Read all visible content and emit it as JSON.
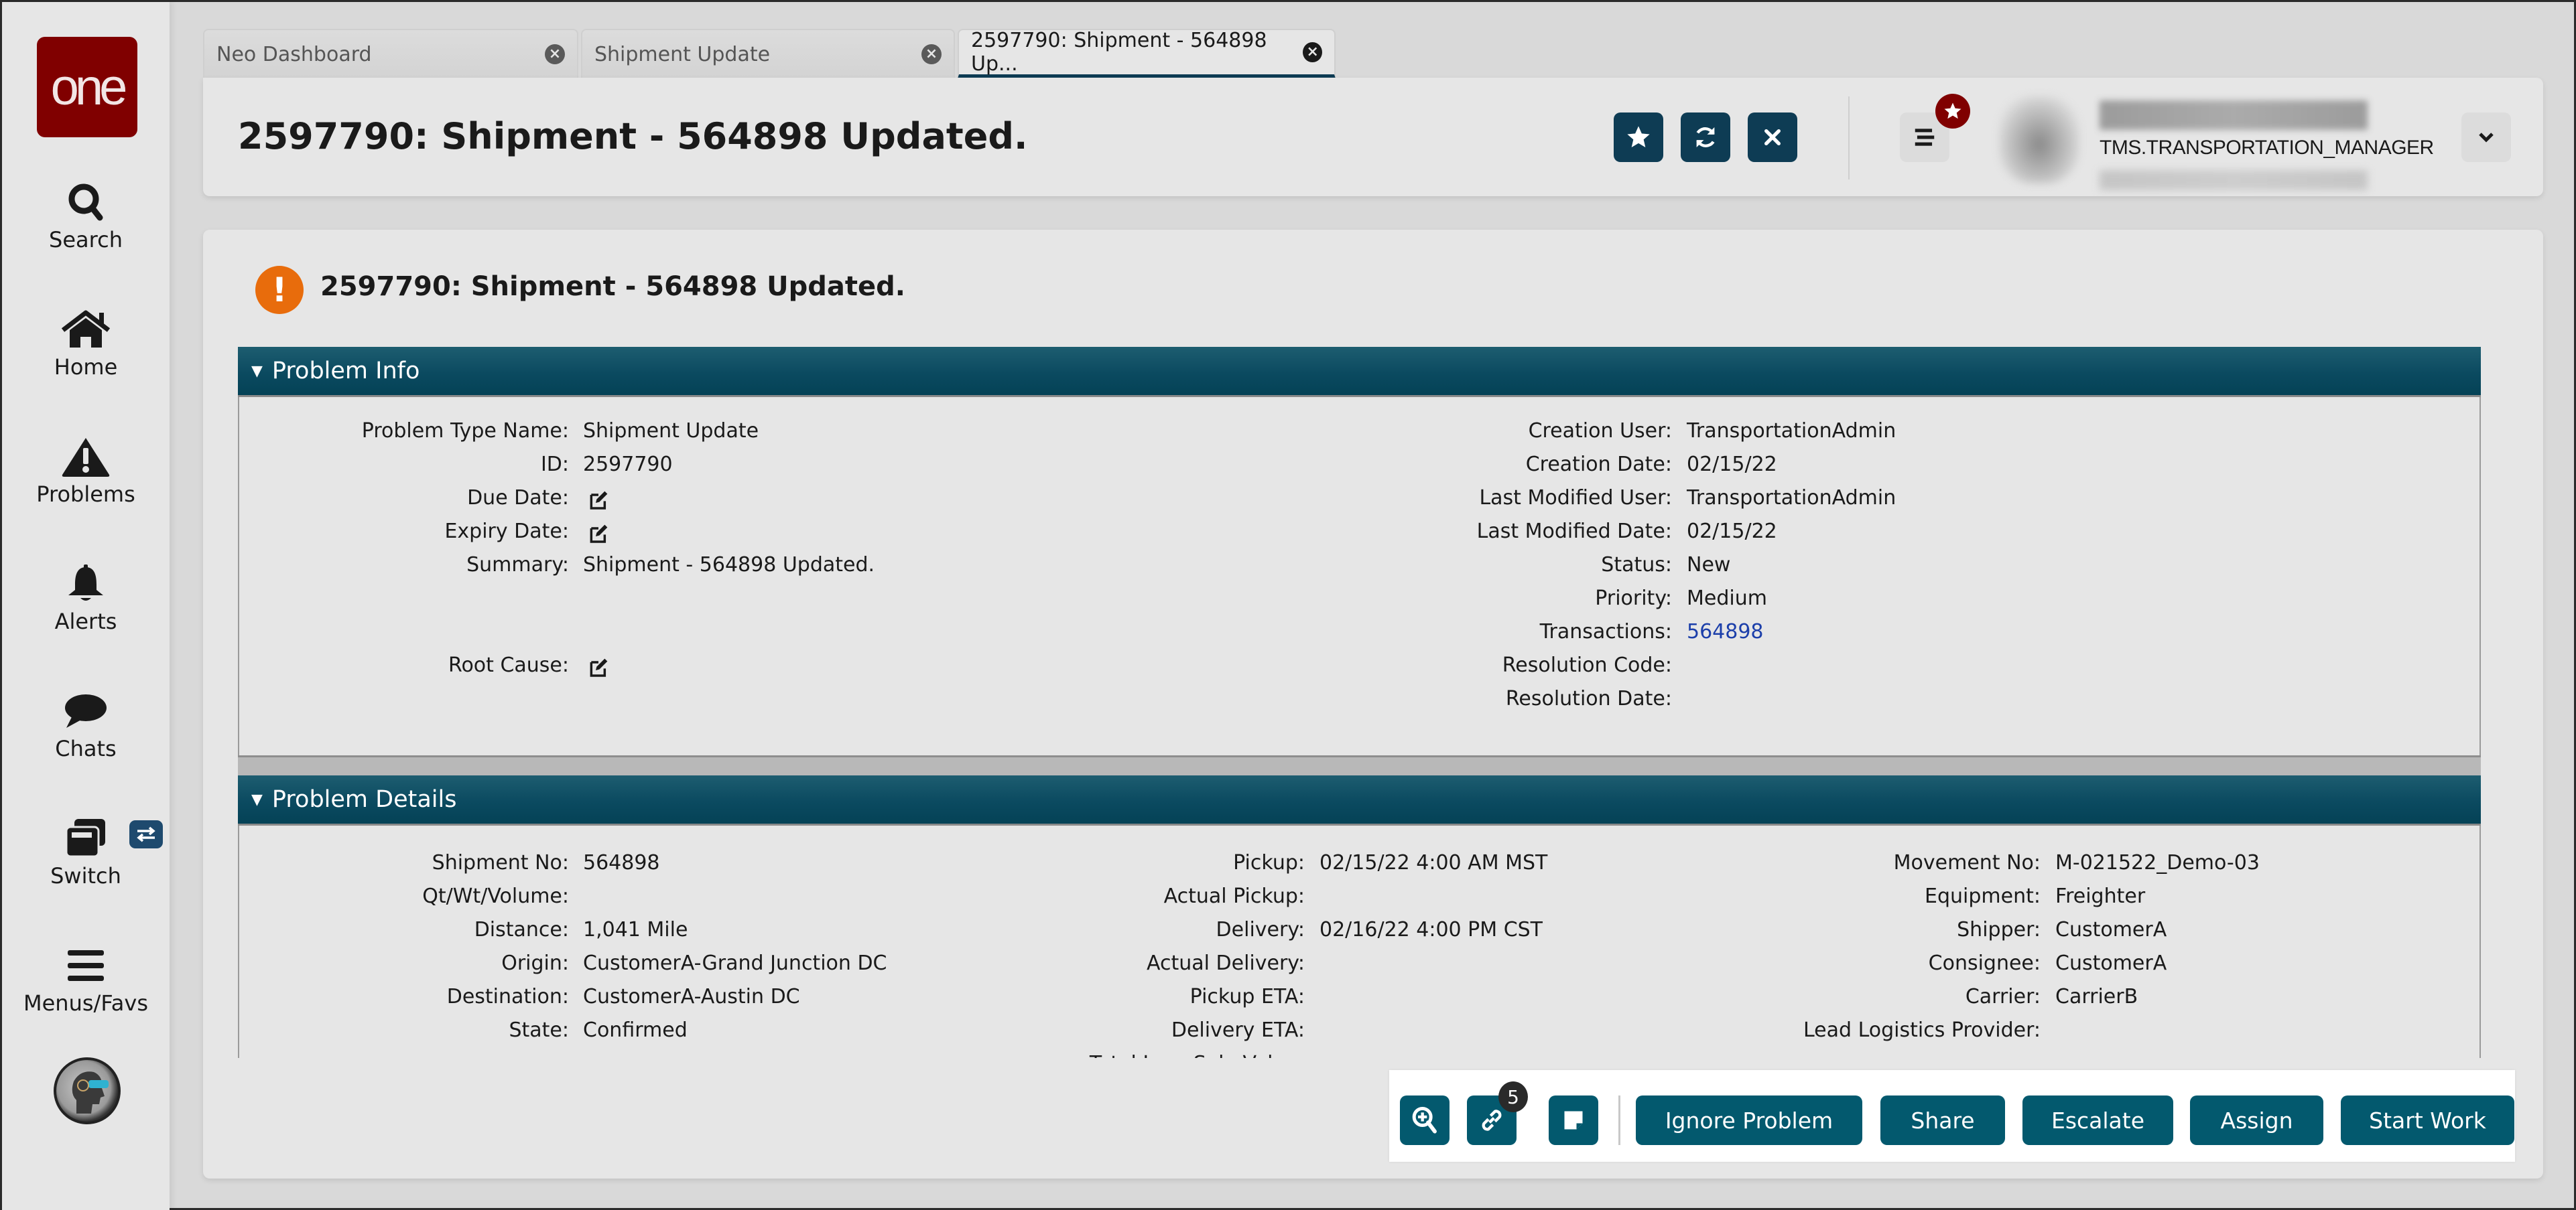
{
  "sidebar": {
    "logo_text": "one",
    "items": [
      {
        "label": "Search",
        "icon": "search-icon"
      },
      {
        "label": "Home",
        "icon": "home-icon"
      },
      {
        "label": "Problems",
        "icon": "warning-triangle-icon"
      },
      {
        "label": "Alerts",
        "icon": "bell-icon"
      },
      {
        "label": "Chats",
        "icon": "chat-bubble-icon"
      },
      {
        "label": "Switch",
        "icon": "windows-stack-icon"
      },
      {
        "label": "Menus/Favs",
        "icon": "hamburger-menu-icon"
      }
    ]
  },
  "tabs": [
    {
      "label": "Neo Dashboard",
      "active": false
    },
    {
      "label": "Shipment Update",
      "active": false
    },
    {
      "label": "2597790: Shipment - 564898 Up...",
      "active": true
    }
  ],
  "header": {
    "title": "2597790: Shipment - 564898 Updated.",
    "buttons": [
      "favorite-star",
      "refresh",
      "close"
    ],
    "user": {
      "name_blurred": "Transportation Manager",
      "role": "TMS.TRANSPORTATION_MANAGER",
      "org_blurred": "Organization"
    }
  },
  "main": {
    "title": "2597790: Shipment - 564898 Updated.",
    "problem_info": {
      "heading": "Problem Info",
      "left": [
        {
          "label": "Problem Type Name:",
          "value": "Shipment Update"
        },
        {
          "label": "ID:",
          "value": "2597790"
        },
        {
          "label": "Due Date:",
          "value": "",
          "editable": true
        },
        {
          "label": "Expiry Date:",
          "value": "",
          "editable": true
        },
        {
          "label": "Summary:",
          "value": "Shipment - 564898 Updated."
        },
        {
          "label": "Root Cause:",
          "value": "",
          "editable": true
        }
      ],
      "right": [
        {
          "label": "Creation User:",
          "value": "TransportationAdmin"
        },
        {
          "label": "Creation Date:",
          "value": "02/15/22"
        },
        {
          "label": "Last Modified User:",
          "value": "TransportationAdmin"
        },
        {
          "label": "Last Modified Date:",
          "value": "02/15/22"
        },
        {
          "label": "Status:",
          "value": "New"
        },
        {
          "label": "Priority:",
          "value": "Medium"
        },
        {
          "label": "Transactions:",
          "value": "564898",
          "link": true
        },
        {
          "label": "Resolution Code:",
          "value": ""
        },
        {
          "label": "Resolution Date:",
          "value": ""
        }
      ]
    },
    "problem_details": {
      "heading": "Problem Details",
      "col1": [
        {
          "label": "Shipment No:",
          "value": "564898"
        },
        {
          "label": "Qt/Wt/Volume:",
          "value": ""
        },
        {
          "label": "Distance:",
          "value": "1,041 Mile"
        },
        {
          "label": "Origin:",
          "value": "CustomerA-Grand Junction DC"
        },
        {
          "label": "Destination:",
          "value": "CustomerA-Austin DC"
        },
        {
          "label": "State:",
          "value": "Confirmed"
        }
      ],
      "col2": [
        {
          "label": "Pickup:",
          "value": "02/15/22 4:00 AM MST"
        },
        {
          "label": "Actual Pickup:",
          "value": ""
        },
        {
          "label": "Delivery:",
          "value": "02/16/22 4:00 PM CST"
        },
        {
          "label": "Actual Delivery:",
          "value": ""
        },
        {
          "label": "Pickup ETA:",
          "value": ""
        },
        {
          "label": "Delivery ETA:",
          "value": ""
        },
        {
          "label": "Total Loss Sale Value:",
          "value": ""
        }
      ],
      "col3": [
        {
          "label": "Movement No:",
          "value": "M-021522_Demo-03"
        },
        {
          "label": "Equipment:",
          "value": "Freighter"
        },
        {
          "label": "Shipper:",
          "value": "CustomerA"
        },
        {
          "label": "Consignee:",
          "value": "CustomerA"
        },
        {
          "label": "Carrier:",
          "value": "CarrierB"
        },
        {
          "label": "Lead Logistics Provider:",
          "value": ""
        }
      ]
    }
  },
  "action_bar": {
    "links_count": "5",
    "buttons": [
      "Ignore Problem",
      "Share",
      "Escalate",
      "Assign",
      "Start Work"
    ]
  },
  "colors": {
    "brand": "#800000",
    "primary": "#0e3c54",
    "action": "#03596e",
    "section_header": "#0b4a60",
    "alert": "#e86c0c",
    "link": "#1c3faa"
  }
}
